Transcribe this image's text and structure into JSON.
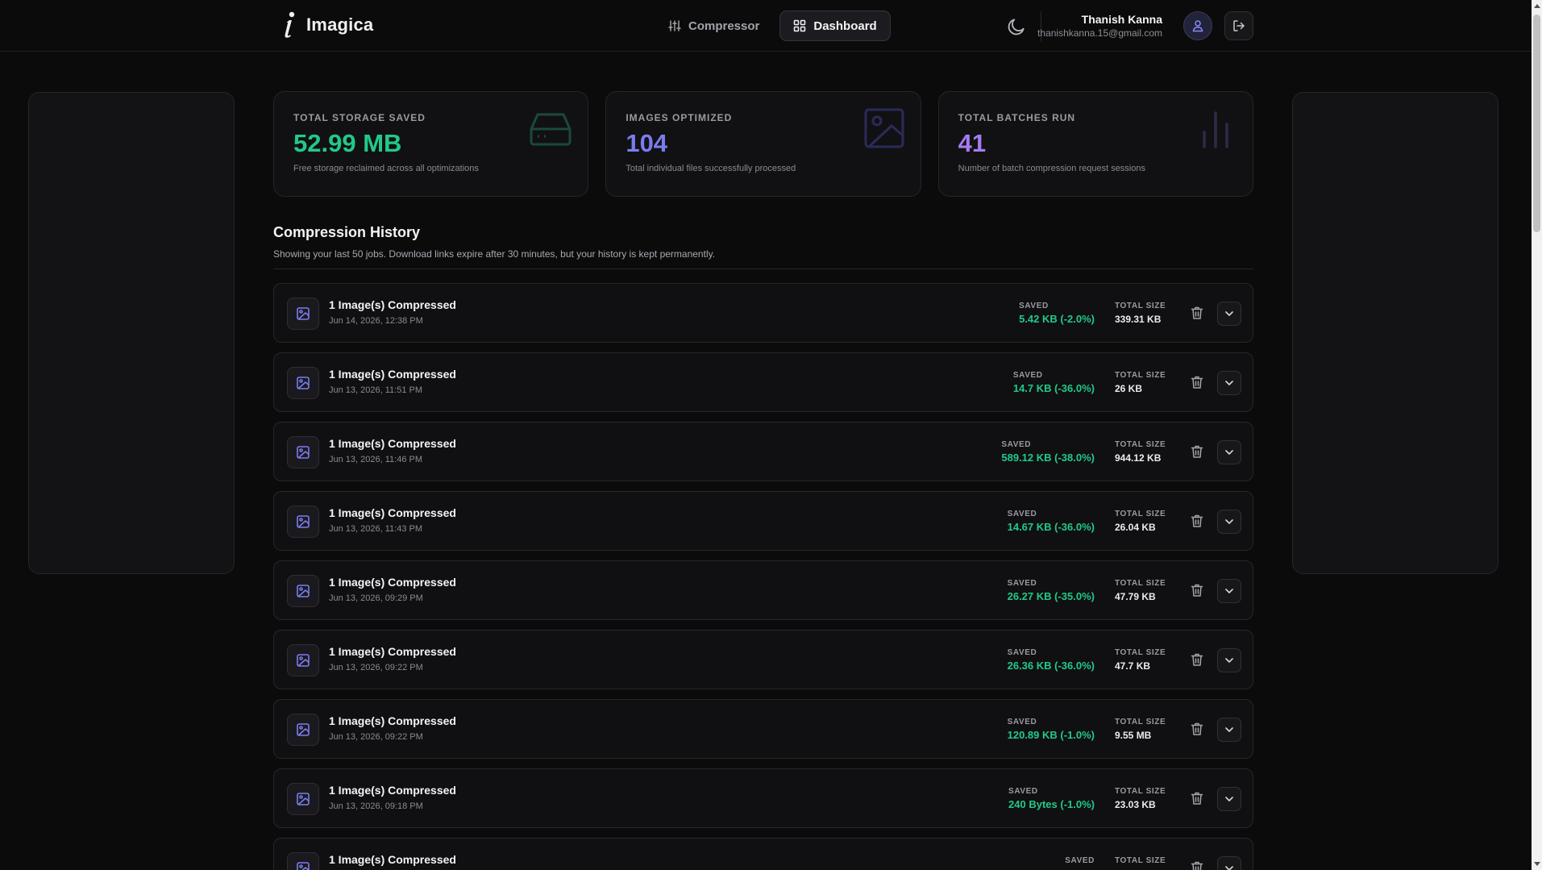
{
  "app": {
    "name": "Imagica"
  },
  "nav": {
    "tabs": [
      {
        "label": "Compressor",
        "active": false
      },
      {
        "label": "Dashboard",
        "active": true
      }
    ]
  },
  "user": {
    "name": "Thanish Kanna",
    "email": "thanishkanna.15@gmail.com"
  },
  "icons": {
    "theme": "moon-icon",
    "avatar": "user-icon",
    "logout": "logout-icon",
    "row": "image-icon",
    "delete": "trash-icon",
    "expand": "chevron-down-icon"
  },
  "stats": [
    {
      "label": "TOTAL STORAGE SAVED",
      "value": "52.99 MB",
      "description": "Free storage reclaimed across all optimizations",
      "color": "#22c98a",
      "icon": "hard-drive-icon"
    },
    {
      "label": "IMAGES OPTIMIZED",
      "value": "104",
      "description": "Total individual files successfully processed",
      "color": "#7c7cf0",
      "icon": "image-icon"
    },
    {
      "label": "TOTAL BATCHES RUN",
      "value": "41",
      "description": "Number of batch compression request sessions",
      "color": "#a57cf0",
      "icon": "bar-chart-icon"
    }
  ],
  "history": {
    "title": "Compression History",
    "subtitle": "Showing your last 50 jobs. Download links expire after 30 minutes, but your history is kept permanently.",
    "saved_label": "SAVED",
    "total_label": "TOTAL SIZE",
    "jobs": [
      {
        "title": "1 Image(s) Compressed",
        "date": "Jun 14, 2026, 12:38 PM",
        "saved": "5.42 KB (-2.0%)",
        "total": "339.31 KB"
      },
      {
        "title": "1 Image(s) Compressed",
        "date": "Jun 13, 2026, 11:51 PM",
        "saved": "14.7 KB (-36.0%)",
        "total": "26 KB"
      },
      {
        "title": "1 Image(s) Compressed",
        "date": "Jun 13, 2026, 11:46 PM",
        "saved": "589.12 KB (-38.0%)",
        "total": "944.12 KB"
      },
      {
        "title": "1 Image(s) Compressed",
        "date": "Jun 13, 2026, 11:43 PM",
        "saved": "14.67 KB (-36.0%)",
        "total": "26.04 KB"
      },
      {
        "title": "1 Image(s) Compressed",
        "date": "Jun 13, 2026, 09:29 PM",
        "saved": "26.27 KB (-35.0%)",
        "total": "47.79 KB"
      },
      {
        "title": "1 Image(s) Compressed",
        "date": "Jun 13, 2026, 09:22 PM",
        "saved": "26.36 KB (-36.0%)",
        "total": "47.7 KB"
      },
      {
        "title": "1 Image(s) Compressed",
        "date": "Jun 13, 2026, 09:22 PM",
        "saved": "120.89 KB (-1.0%)",
        "total": "9.55 MB"
      },
      {
        "title": "1 Image(s) Compressed",
        "date": "Jun 13, 2026, 09:18 PM",
        "saved": "240 Bytes (-1.0%)",
        "total": "23.03 KB"
      },
      {
        "title": "1 Image(s) Compressed",
        "date": "",
        "saved": "",
        "total": ""
      }
    ]
  }
}
